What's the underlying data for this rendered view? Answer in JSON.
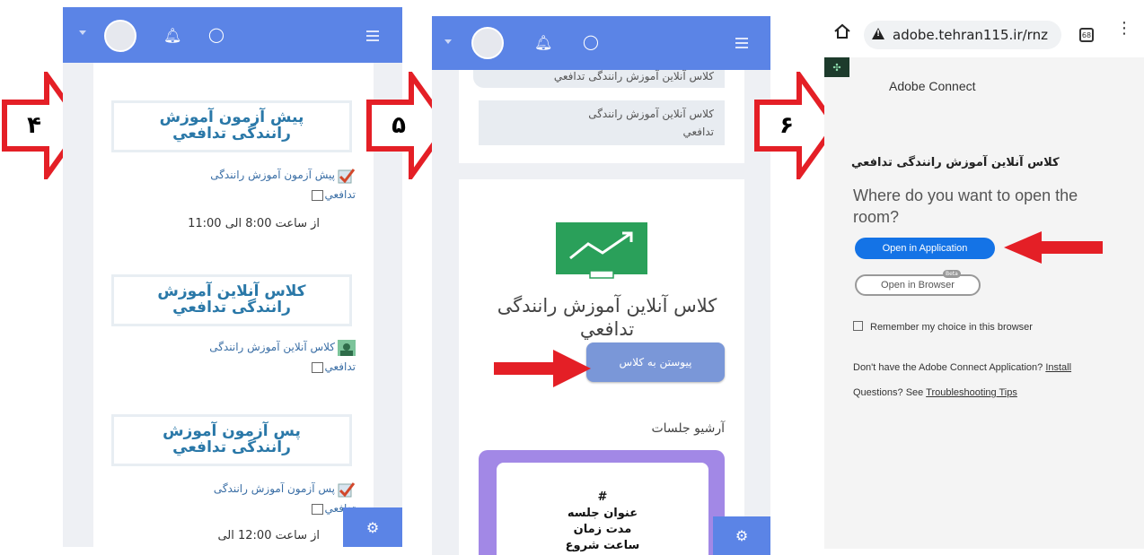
{
  "colors": {
    "topbar": "#5b84e6",
    "step_arrow": "#e41f26",
    "title_text": "#2a78a8",
    "adobe_primary": "#1473e6"
  },
  "steps": [
    "۴",
    "۵",
    "۶"
  ],
  "panel1": {
    "header_icons": [
      "user-avatar",
      "bell-icon",
      "chat-icon",
      "menu-icon"
    ],
    "items": [
      {
        "title": "پیش آزمون آموزش رانندگی تدافعي",
        "link": "پیش آزمون آموزش رانندگی تدافعي",
        "time": "از ساعت 8:00 الی 11:00"
      },
      {
        "title": "کلاس آنلاین آموزش رانندگی تدافعي",
        "link": "کلاس آنلاین آموزش رانندگی تدافعي",
        "time": ""
      },
      {
        "title": "پس آزمون آموزش رانندگی تدافعي",
        "link": "پس آزمون آموزش رانندگی تدافعي",
        "time": "از ساعت 12:00 الی"
      }
    ]
  },
  "panel2": {
    "chip_top": "کلاس آنلاین آموزش رانندگی تدافعي",
    "chip_second": "کلاس آنلاین آموزش رانندگی تدافعي",
    "class_title": "کلاس آنلاین آموزش رانندگی تدافعي",
    "join_button": "پیوستن به کلاس",
    "archive_heading": "آرشیو جلسات",
    "table_head": [
      "#",
      "عنوان جلسه",
      "مدت زمان",
      "ساعت شروع"
    ]
  },
  "panel3": {
    "url": "adobe.tehran115.ir/rnz",
    "tab_count": "68",
    "app_name": "Adobe Connect",
    "room_name": "کلاس آنلاین آموزش رانندگی تدافعي",
    "question": "Where do you want to open the room?",
    "open_app": "Open in Application",
    "open_browser": "Open in Browser",
    "beta": "Beta",
    "remember": "Remember my choice in this browser",
    "no_app": "Don't have the Adobe Connect Application?",
    "install": "Install",
    "questions": "Questions? See",
    "tips": "Troubleshooting Tips"
  }
}
